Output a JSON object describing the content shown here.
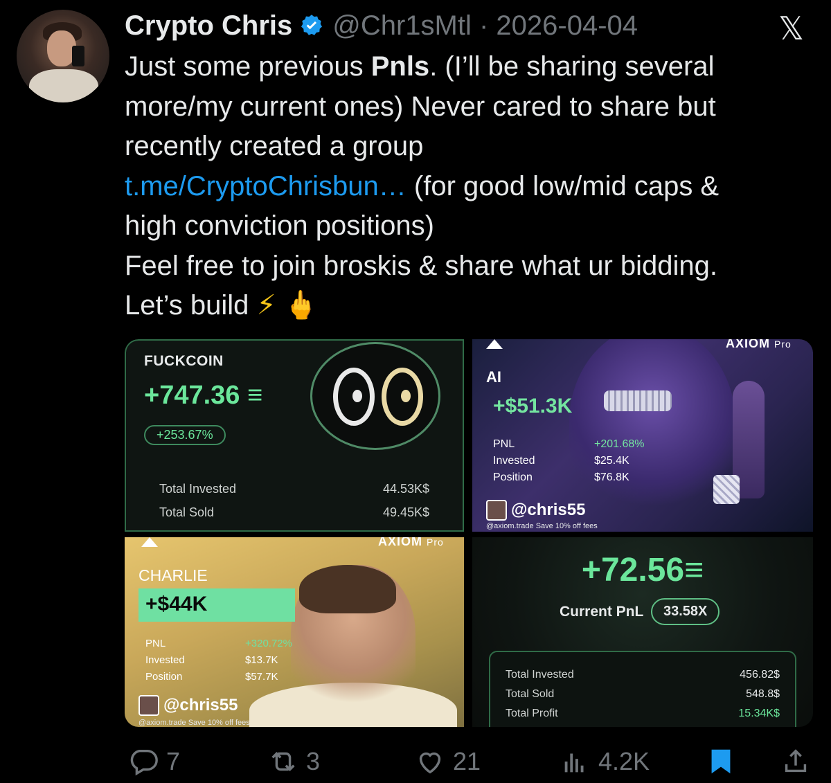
{
  "author": {
    "name": "Crypto Chris",
    "handle_date": "@Chr1sMtl · 2026-04-04"
  },
  "tweet": {
    "line1_a": "Just some previous ",
    "line1_b": "Pnls",
    "line1_c": ". (I’ll be sharing several",
    "line2": "more/my current ones) Never cared to share but",
    "line3": "recently created a group",
    "link": "t.me/CryptoChrisbun…",
    "line4_rest": "  (for good low/mid caps &",
    "line5": "high conviction positions)",
    "line6": "Feel free to join broskis & share what ur bidding.",
    "line7": "Let’s build",
    "emoji_bolt": "⚡",
    "emoji_hand": "🖕"
  },
  "cards": {
    "fuckcoin": {
      "ticker": "FUCKCOIN",
      "pnl": "+747.36 ≡",
      "pct": "+253.67%",
      "total_invested_label": "Total Invested",
      "total_invested_value": "44.53K$",
      "total_sold_label": "Total Sold",
      "total_sold_value": "49.45K$"
    },
    "ai": {
      "brand": "AXIOM",
      "brand_suffix": "Pro",
      "symbol": "AI",
      "pnl": "+$51.3K",
      "pnl_label": "PNL",
      "pnl_value": "+201.68%",
      "invested_label": "Invested",
      "invested_value": "$25.4K",
      "position_label": "Position",
      "position_value": "$76.8K",
      "user": "@chris55",
      "promo": "@axiom.trade   Save 10% off fees"
    },
    "charlie": {
      "brand": "AXIOM",
      "brand_suffix": "Pro",
      "symbol": "CHARLIE",
      "pnl": "+$44K",
      "pnl_label": "PNL",
      "pnl_value": "+320.72%",
      "invested_label": "Invested",
      "invested_value": "$13.7K",
      "position_label": "Position",
      "position_value": "$57.7K",
      "user": "@chris55",
      "promo": "@axiom.trade   Save 10% off fees"
    },
    "current": {
      "pnl": "+72.56≡",
      "current_label": "Current PnL",
      "multiplier": "33.58X",
      "total_invested_label": "Total Invested",
      "total_invested_value": "456.82$",
      "total_sold_label": "Total Sold",
      "total_sold_value": "548.8$",
      "total_profit_label": "Total Profit",
      "total_profit_value": "15.34K$"
    }
  },
  "actions": {
    "replies": "7",
    "reposts": "3",
    "likes": "21",
    "views": "4.2K"
  },
  "colors": {
    "background": "#000000",
    "text": "#e7e9ea",
    "muted": "#71767b",
    "link": "#1d9bf0",
    "verified": "#1d9bf0",
    "bookmark": "#1d9bf0",
    "pnl_green": "#6be69b"
  },
  "icons": [
    "verified-badge-icon",
    "x-logo-icon",
    "reply-icon",
    "repost-icon",
    "like-icon",
    "views-icon",
    "bookmark-icon",
    "share-icon"
  ]
}
